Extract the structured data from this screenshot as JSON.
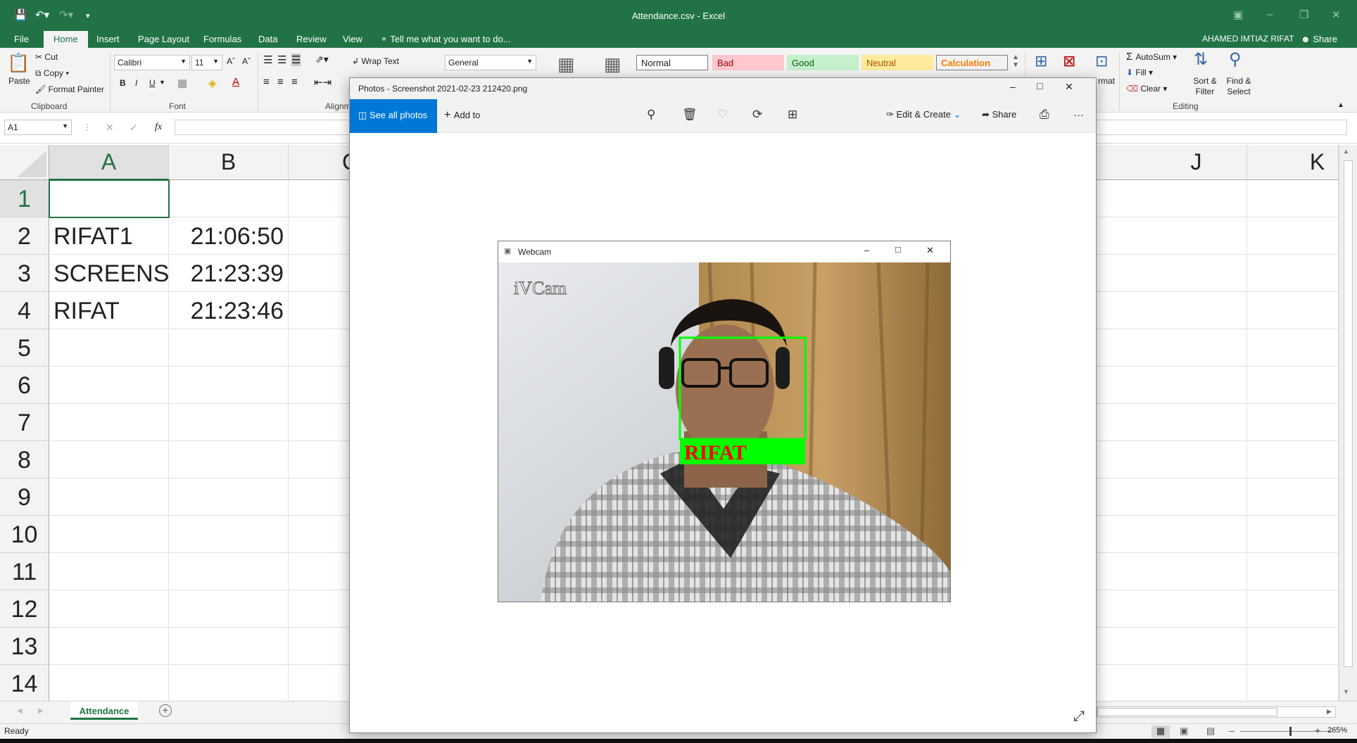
{
  "excel": {
    "window_title": "Attendance.csv - Excel",
    "user_name": "AHAMED IMTIAZ RIFAT",
    "share_label": "Share",
    "tabs": [
      "File",
      "Home",
      "Insert",
      "Page Layout",
      "Formulas",
      "Data",
      "Review",
      "View"
    ],
    "active_tab": "Home",
    "tell_me": "Tell me what you want to do...",
    "clipboard": {
      "paste": "Paste",
      "cut": "Cut",
      "copy": "Copy",
      "format_painter": "Format Painter",
      "label": "Clipboard"
    },
    "font": {
      "name": "Calibri",
      "size": "11",
      "label": "Font",
      "bold": "B",
      "italic": "I",
      "underline": "U"
    },
    "alignment": {
      "wrap_text": "Wrap Text",
      "label": "Alignm"
    },
    "number_format": "General",
    "styles": [
      "Normal",
      "Bad",
      "Good",
      "Neutral",
      "Calculation"
    ],
    "cells_partial": "rmat",
    "editing": {
      "autosum": "AutoSum",
      "fill": "Fill",
      "clear": "Clear",
      "sort_filter": "Sort & Filter",
      "find_select": "Find & Select",
      "label": "Editing"
    },
    "name_box": "A1",
    "fx": "fx",
    "columns": [
      "A",
      "B",
      "C",
      "J",
      "K"
    ],
    "rows": [
      "1",
      "2",
      "3",
      "4",
      "5",
      "6",
      "7",
      "8",
      "9",
      "10",
      "11",
      "12",
      "13",
      "14"
    ],
    "cells": [
      {
        "a": "",
        "b": ""
      },
      {
        "a": "RIFAT1",
        "b": "21:06:50"
      },
      {
        "a": "SCREENSH",
        "b": "21:23:39"
      },
      {
        "a": "RIFAT",
        "b": "21:23:46"
      }
    ],
    "sheet_tab": "Attendance",
    "status_ready": "Ready",
    "zoom": "265%"
  },
  "photos": {
    "window_title": "Photos - Screenshot 2021-02-23 212420.png",
    "see_all": "See all photos",
    "add_to": "Add to",
    "edit_create": "Edit & Create",
    "share": "Share",
    "more": "···"
  },
  "webcam": {
    "window_title": "Webcam",
    "watermark": "iVCam",
    "face_label": "RIFAT",
    "box_color": "#00ff00",
    "label_color": "#ff0000"
  },
  "colors": {
    "excel_green": "#217346",
    "photos_accent": "#0078d7"
  }
}
